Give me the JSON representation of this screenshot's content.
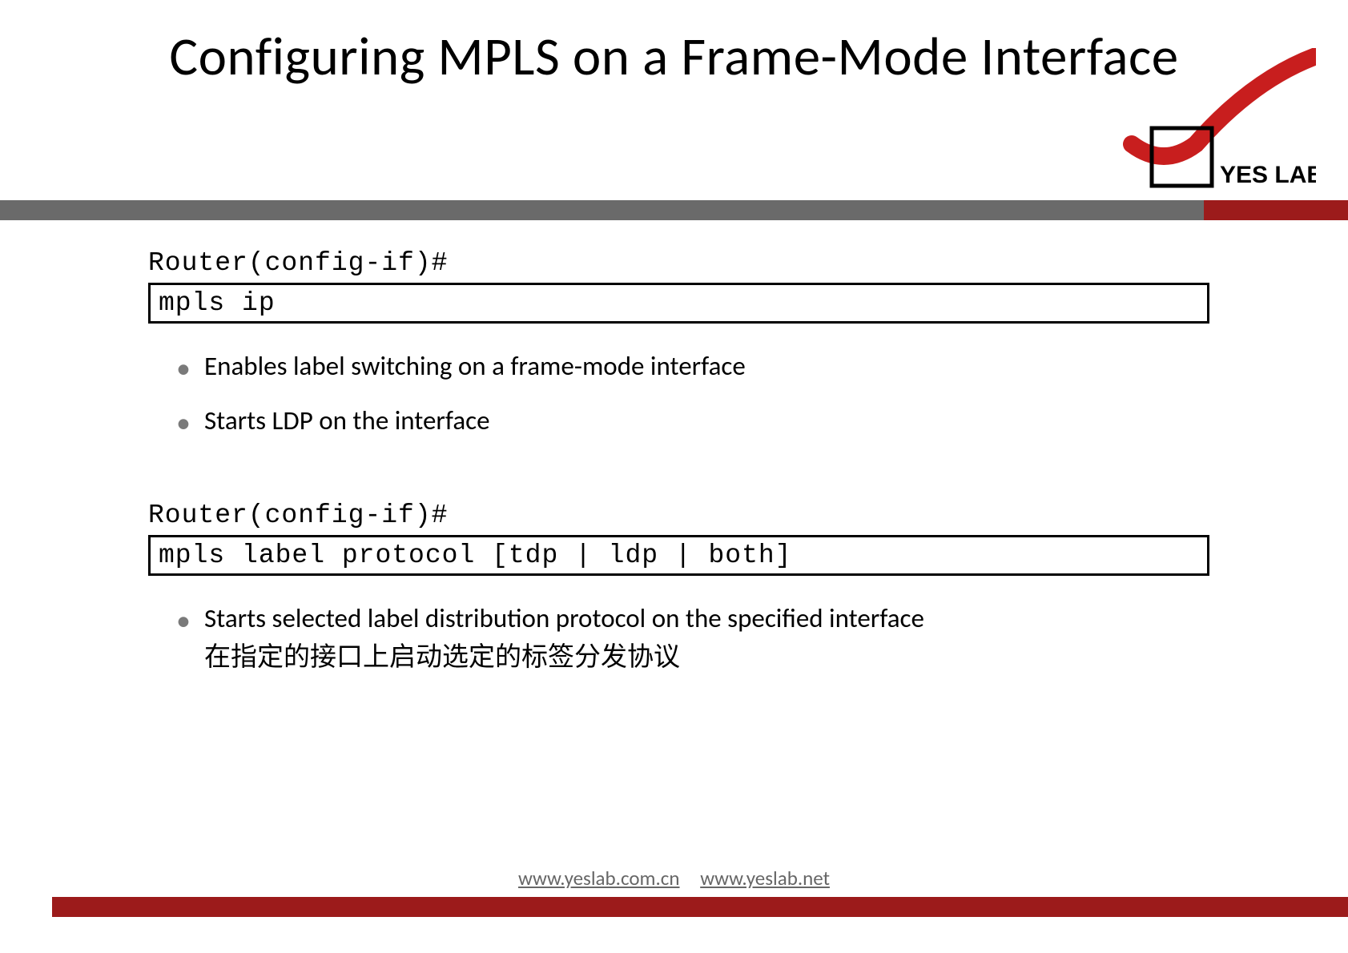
{
  "title": "Configuring MPLS on a Frame-Mode Interface",
  "logo_text": "YES LAB",
  "section1": {
    "prompt": "Router(config-if)#",
    "command": "mpls ip",
    "bullets": [
      "Enables label switching on a frame-mode interface",
      "Starts LDP on the interface"
    ]
  },
  "section2": {
    "prompt": "Router(config-if)#",
    "command": "mpls label protocol [tdp | ldp | both]",
    "bullet_main": "Starts selected label distribution protocol on the specified interface",
    "bullet_sub": "在指定的接口上启动选定的标签分发协议"
  },
  "footer": {
    "link1": "www.yeslab.com.cn",
    "link2": "www.yeslab.net"
  }
}
